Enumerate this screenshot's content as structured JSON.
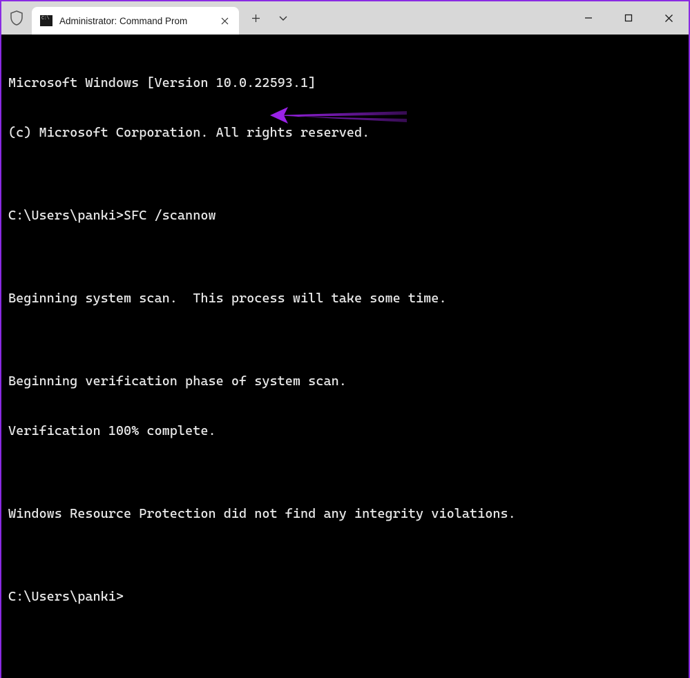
{
  "titlebar": {
    "tab": {
      "title": "Administrator: Command Prom"
    }
  },
  "terminal": {
    "lines": [
      "Microsoft Windows [Version 10.0.22593.1]",
      "(c) Microsoft Corporation. All rights reserved.",
      "",
      "C:\\Users\\panki>SFC /scannow",
      "",
      "Beginning system scan.  This process will take some time.",
      "",
      "Beginning verification phase of system scan.",
      "Verification 100% complete.",
      "",
      "Windows Resource Protection did not find any integrity violations.",
      "",
      "C:\\Users\\panki>"
    ]
  },
  "annotation": {
    "color": "#9a22e8"
  }
}
